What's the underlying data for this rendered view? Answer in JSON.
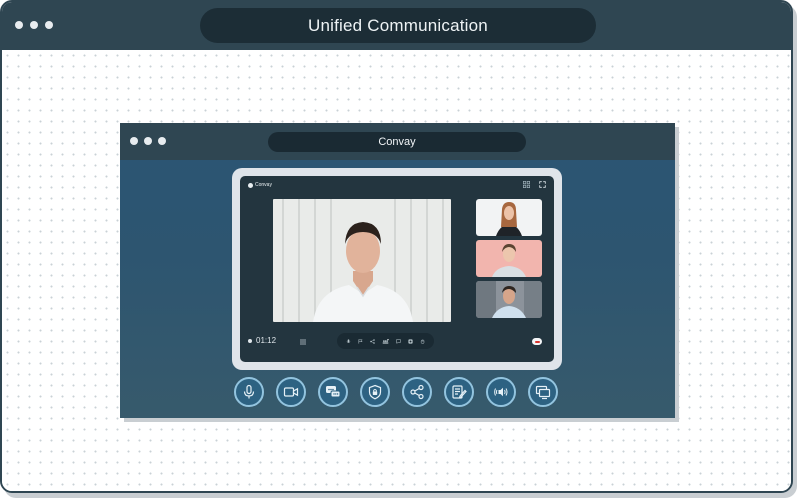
{
  "outer_window": {
    "title": "Unified Communication",
    "dot_colors": [
      "#e8ecef",
      "#e8ecef",
      "#e8ecef"
    ]
  },
  "inner_window": {
    "title": "Convay",
    "dot_colors": [
      "#e8ecef",
      "#e8ecef",
      "#e8ecef"
    ]
  },
  "meeting": {
    "brand": "Convay",
    "timer": "01:12",
    "participants": [
      "main-speaker",
      "participant-2",
      "participant-3",
      "participant-4"
    ],
    "call_controls": [
      "mic-icon",
      "flag-icon",
      "share-icon",
      "participants-icon",
      "chat-icon",
      "record-icon",
      "hand-icon"
    ]
  },
  "toolbar": {
    "buttons": [
      "microphone",
      "video-camera",
      "chat",
      "security",
      "share",
      "notes",
      "audio",
      "screen-share"
    ]
  },
  "colors": {
    "frame": "#2f4652",
    "title_pill": "#1c2d36",
    "accent_ring": "#93c4df",
    "button_fill": "#2d6282",
    "hangup_red": "#d8342f"
  }
}
